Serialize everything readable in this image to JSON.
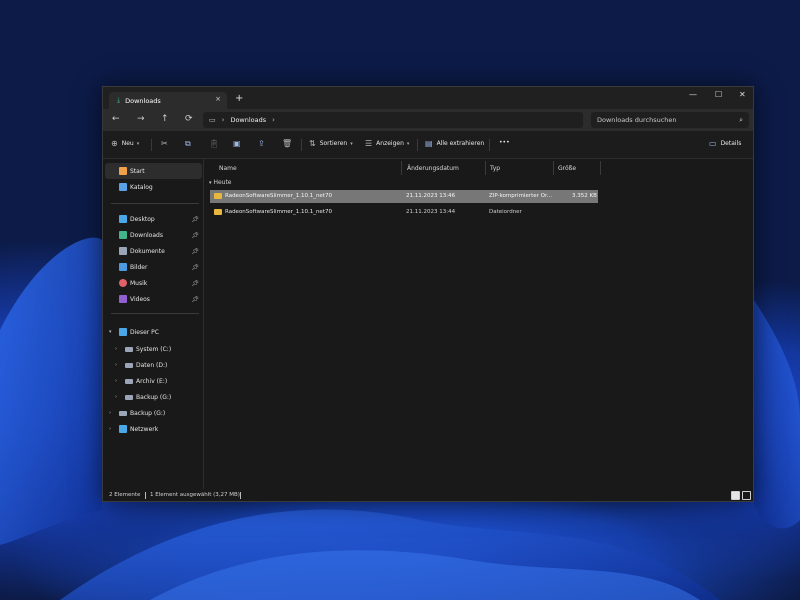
{
  "window": {
    "tab_label": "Downloads",
    "tab_close": "×",
    "new_tab": "+",
    "minimize": "—",
    "maximize": "☐",
    "close": "✕"
  },
  "nav": {
    "back": "←",
    "forward": "→",
    "up": "↑",
    "refresh": "⟳",
    "address_path": "Downloads",
    "search_placeholder": "Downloads durchsuchen"
  },
  "toolbar": {
    "new_label": "Neu",
    "sort_label": "Sortieren",
    "view_label": "Anzeigen",
    "extract_label": "Alle extrahieren",
    "more_label": "•••",
    "details_label": "Details"
  },
  "sidebar": {
    "items": [
      {
        "label": "Start",
        "icon": "home-icon",
        "color": "#f0a24a"
      },
      {
        "label": "Katalog",
        "icon": "gallery-icon",
        "color": "#5aa0e6"
      },
      {
        "label": "Desktop",
        "icon": "desktop-icon",
        "color": "#4aa8e8"
      },
      {
        "label": "Downloads",
        "icon": "download-icon",
        "color": "#43b58a"
      },
      {
        "label": "Dokumente",
        "icon": "document-icon",
        "color": "#9aa6b8"
      },
      {
        "label": "Bilder",
        "icon": "pictures-icon",
        "color": "#4c9be0"
      },
      {
        "label": "Musik",
        "icon": "music-icon",
        "color": "#e0606a"
      },
      {
        "label": "Videos",
        "icon": "videos-icon",
        "color": "#9060d0"
      },
      {
        "label": "Dieser PC",
        "icon": "pc-icon",
        "color": "#4aa8e8"
      },
      {
        "label": "System (C:)",
        "icon": "drive-icon",
        "color": "#9aa6b8"
      },
      {
        "label": "Daten (D:)",
        "icon": "drive-icon",
        "color": "#9aa6b8"
      },
      {
        "label": "Archiv (E:)",
        "icon": "drive-icon",
        "color": "#9aa6b8"
      },
      {
        "label": "Backup (G:)",
        "icon": "drive-icon",
        "color": "#9aa6b8"
      },
      {
        "label": "Backup (G:)",
        "icon": "drive-icon",
        "color": "#9aa6b8"
      },
      {
        "label": "Netzwerk",
        "icon": "network-icon",
        "color": "#4aa8e8"
      }
    ]
  },
  "columns": {
    "name": "Name",
    "date": "Änderungsdatum",
    "type": "Typ",
    "size": "Größe"
  },
  "group": {
    "label": "Heute"
  },
  "files": [
    {
      "name": "RadeonSoftwareSlimmer_1.10.1_net70",
      "date": "21.11.2023 13:46",
      "type": "ZIP-komprimierter Or...",
      "size": "3.352 KB"
    },
    {
      "name": "RadeonSoftwareSlimmer_1.10.1_net70",
      "date": "21.11.2023 13:44",
      "type": "Dateiordner",
      "size": ""
    }
  ],
  "status": {
    "count": "2 Elemente",
    "selected": "1 Element ausgewählt (3,27 MB)"
  }
}
